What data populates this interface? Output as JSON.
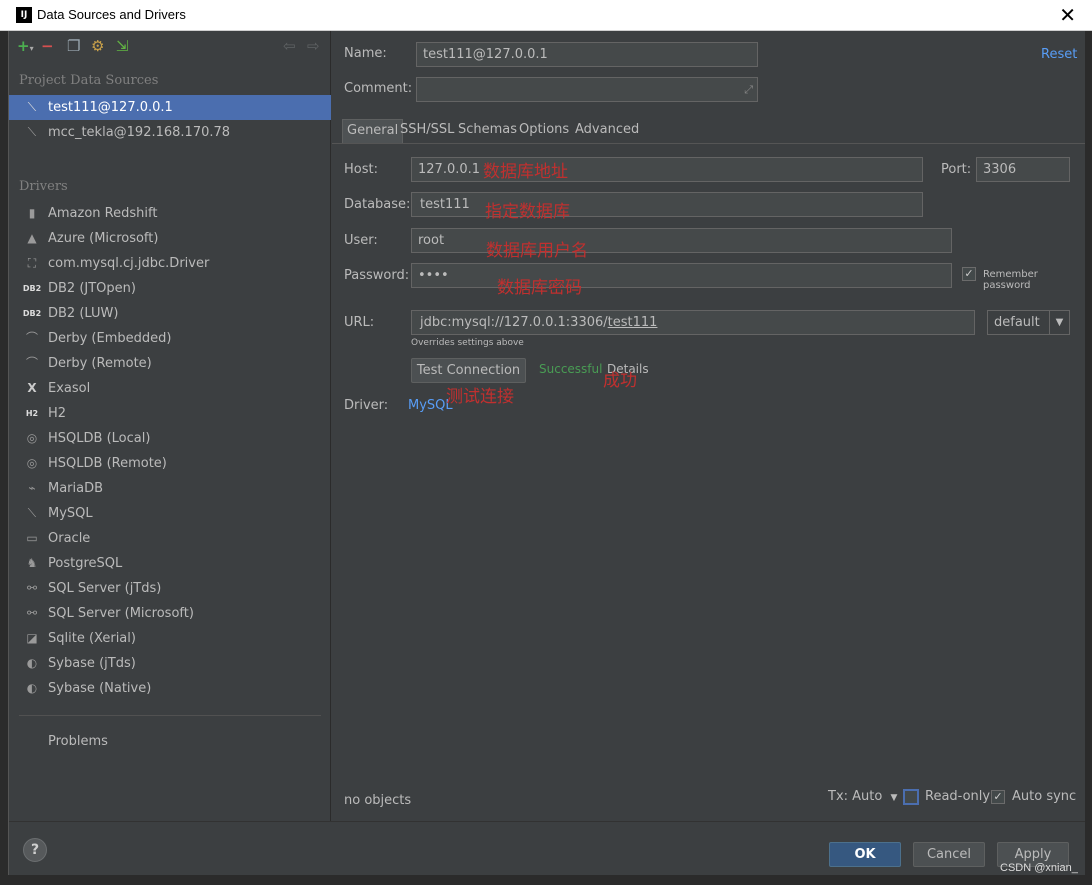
{
  "window": {
    "app_icon": "IJ",
    "title": "Data Sources and Drivers",
    "close": "✕"
  },
  "left_panel": {
    "toolbar_icons": [
      "add-icon",
      "remove-icon",
      "duplicate-icon",
      "driver-settings-icon",
      "import-icon",
      "back-icon",
      "forward-icon"
    ],
    "project_section": "Project Data Sources",
    "data_sources": [
      {
        "label": "test111@127.0.0.1",
        "icon": "mysql-dolphin-icon",
        "selected": true
      },
      {
        "label": "mcc_tekla@192.168.170.78",
        "icon": "mysql-dolphin-icon",
        "selected": false
      }
    ],
    "drivers_section": "Drivers",
    "drivers": [
      {
        "label": "Amazon Redshift",
        "icon": "redshift-icon"
      },
      {
        "label": "Azure (Microsoft)",
        "icon": "azure-icon"
      },
      {
        "label": "com.mysql.cj.jdbc.Driver",
        "icon": "generic-driver-icon"
      },
      {
        "label": "DB2 (JTOpen)",
        "icon": "db2-icon"
      },
      {
        "label": "DB2 (LUW)",
        "icon": "db2-icon"
      },
      {
        "label": "Derby (Embedded)",
        "icon": "derby-hat-icon"
      },
      {
        "label": "Derby (Remote)",
        "icon": "derby-hat-icon"
      },
      {
        "label": "Exasol",
        "icon": "exasol-icon"
      },
      {
        "label": "H2",
        "icon": "h2-icon"
      },
      {
        "label": "HSQLDB (Local)",
        "icon": "hsqldb-icon"
      },
      {
        "label": "HSQLDB (Remote)",
        "icon": "hsqldb-icon"
      },
      {
        "label": "MariaDB",
        "icon": "mariadb-seal-icon"
      },
      {
        "label": "MySQL",
        "icon": "mysql-dolphin-icon"
      },
      {
        "label": "Oracle",
        "icon": "oracle-icon"
      },
      {
        "label": "PostgreSQL",
        "icon": "postgresql-elephant-icon"
      },
      {
        "label": "SQL Server (jTds)",
        "icon": "sqlserver-icon"
      },
      {
        "label": "SQL Server (Microsoft)",
        "icon": "sqlserver-icon"
      },
      {
        "label": "Sqlite (Xerial)",
        "icon": "sqlite-icon"
      },
      {
        "label": "Sybase (jTds)",
        "icon": "sybase-icon"
      },
      {
        "label": "Sybase (Native)",
        "icon": "sybase-icon"
      }
    ],
    "problems": "Problems"
  },
  "right_panel": {
    "name_label": "Name:",
    "name_value": "test111@127.0.0.1",
    "reset": "Reset",
    "comment_label": "Comment:",
    "comment_value": "",
    "tabs": [
      "General",
      "SSH/SSL",
      "Schemas",
      "Options",
      "Advanced"
    ],
    "active_tab": "General",
    "host_label": "Host:",
    "host_value": "127.0.0.1",
    "port_label": "Port:",
    "port_value": "3306",
    "database_label": "Database:",
    "database_value": "test111",
    "user_label": "User:",
    "user_value": "root",
    "password_label": "Password:",
    "password_value": "••••",
    "remember_password": "Remember password",
    "remember_checked": true,
    "url_label": "URL:",
    "url_prefix": "jdbc:mysql://127.0.0.1:3306/",
    "url_db": "test111",
    "url_mode": "default",
    "overrides_note": "Overrides settings above",
    "test_connection": "Test Connection",
    "status": "Successful",
    "details": "Details",
    "driver_label": "Driver:",
    "driver_value": "MySQL",
    "no_objects": "no objects",
    "tx_mode": "Tx: Auto",
    "read_only": "Read-only",
    "read_only_checked": false,
    "auto_sync": "Auto sync",
    "auto_sync_checked": true
  },
  "annotations": {
    "host": "数据库地址",
    "database": "指定数据库",
    "user": "数据库用户名",
    "password": "数据库密码",
    "success": "成功",
    "test": "测试连接"
  },
  "buttons": {
    "ok": "OK",
    "cancel": "Cancel",
    "apply": "Apply",
    "help": "?"
  },
  "watermark": "CSDN @xnian_",
  "colors": {
    "accent": "#4b6eaf",
    "link": "#589df6",
    "success": "#499c54",
    "annotation": "#c0302f",
    "ok_button": "#365880"
  }
}
